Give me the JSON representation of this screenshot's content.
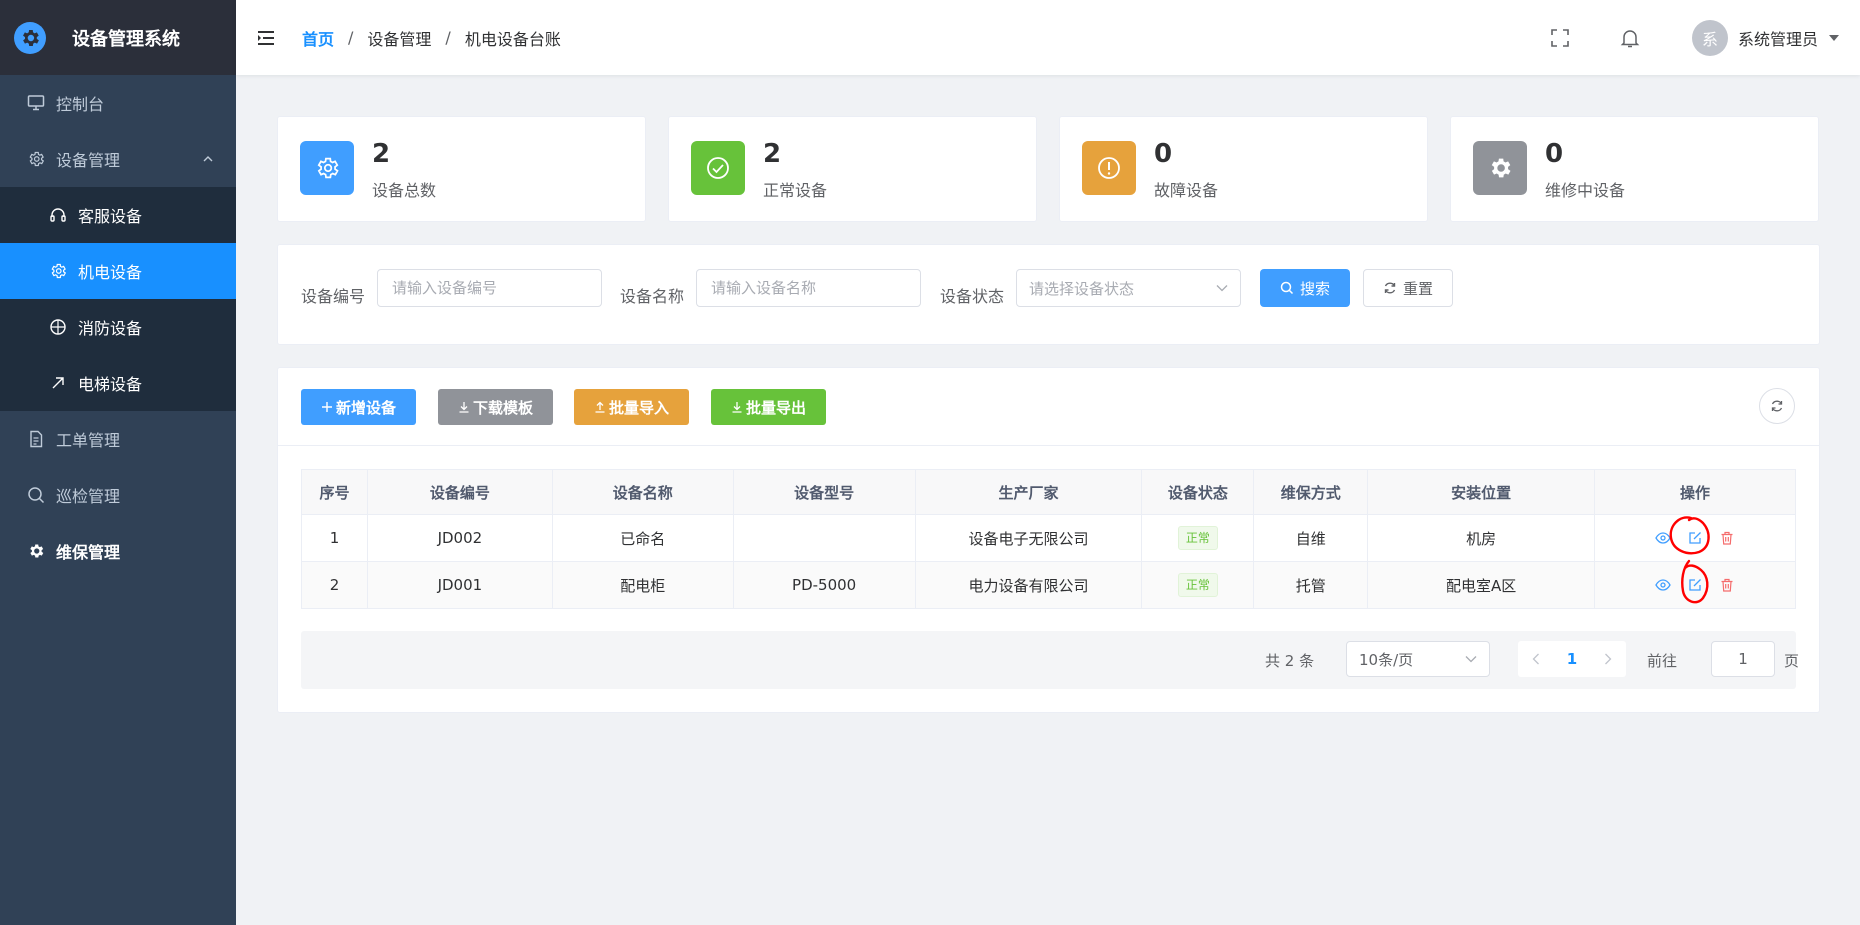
{
  "app": {
    "title": "设备管理系统"
  },
  "sidebar": {
    "items": [
      {
        "label": "控制台",
        "icon": "monitor-icon"
      },
      {
        "label": "设备管理",
        "icon": "gear-icon",
        "expanded": true,
        "children": [
          {
            "label": "客服设备",
            "icon": "headset-icon"
          },
          {
            "label": "机电设备",
            "icon": "gear-icon",
            "active": true
          },
          {
            "label": "消防设备",
            "icon": "crosshair-icon"
          },
          {
            "label": "电梯设备",
            "icon": "arrow-up-right-icon"
          }
        ]
      },
      {
        "label": "工单管理",
        "icon": "document-icon"
      },
      {
        "label": "巡检管理",
        "icon": "search-icon"
      },
      {
        "label": "维保管理",
        "icon": "gear-solid-icon"
      }
    ]
  },
  "header": {
    "breadcrumb": [
      "首页",
      "设备管理",
      "机电设备台账"
    ],
    "avatar_text": "系",
    "username": "系统管理员"
  },
  "stats": [
    {
      "value": "2",
      "label": "设备总数",
      "color": "#409eff",
      "icon": "gear-icon"
    },
    {
      "value": "2",
      "label": "正常设备",
      "color": "#67c23a",
      "icon": "check-circle-icon"
    },
    {
      "value": "0",
      "label": "故障设备",
      "color": "#e6a23c",
      "icon": "warning-circle-icon"
    },
    {
      "value": "0",
      "label": "维修中设备",
      "color": "#909399",
      "icon": "gear-solid-icon"
    }
  ],
  "search": {
    "code_label": "设备编号",
    "code_placeholder": "请输入设备编号",
    "name_label": "设备名称",
    "name_placeholder": "请输入设备名称",
    "status_label": "设备状态",
    "status_placeholder": "请选择设备状态",
    "search_btn": "搜索",
    "reset_btn": "重置"
  },
  "toolbar": {
    "add": "新增设备",
    "download": "下载模板",
    "import": "批量导入",
    "export": "批量导出"
  },
  "table": {
    "columns": [
      "序号",
      "设备编号",
      "设备名称",
      "设备型号",
      "生产厂家",
      "设备状态",
      "维保方式",
      "安装位置",
      "操作"
    ],
    "rows": [
      {
        "no": "1",
        "code": "JD002",
        "name": "已命名",
        "model": "",
        "maker": "设备电子无限公司",
        "status": "正常",
        "maint": "自维",
        "location": "机房"
      },
      {
        "no": "2",
        "code": "JD001",
        "name": "配电柜",
        "model": "PD-5000",
        "maker": "电力设备有限公司",
        "status": "正常",
        "maint": "托管",
        "location": "配电室A区"
      }
    ]
  },
  "pagination": {
    "total_text": "共 2 条",
    "page_size": "10条/页",
    "current_page": "1",
    "goto_label": "前往",
    "goto_value": "1",
    "page_unit": "页"
  },
  "colors": {
    "primary": "#409eff",
    "active_menu": "#1890ff",
    "sidebar": "#304156",
    "annotation": "#ff0000"
  }
}
